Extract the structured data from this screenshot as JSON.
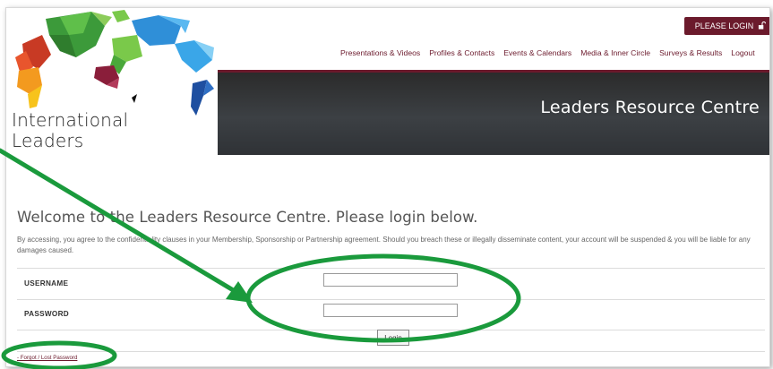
{
  "header": {
    "logo_line1": "International",
    "logo_line2": "Leaders",
    "login_button": "PLEASE LOGIN",
    "login_icon": "unlock-icon"
  },
  "nav": {
    "items": [
      {
        "label": "Presentations & Videos"
      },
      {
        "label": "Profiles & Contacts"
      },
      {
        "label": "Events & Calendars"
      },
      {
        "label": "Media & Inner Circle"
      },
      {
        "label": "Surveys & Results"
      },
      {
        "label": "Logout"
      }
    ]
  },
  "banner": {
    "title": "Leaders Resource Centre"
  },
  "main": {
    "welcome": "Welcome to the Leaders Resource Centre. Please login below.",
    "notice": "By accessing, you agree to the confidentiality clauses in your Membership, Sponsorship or Partnership agreement. Should you breach these or illegally disseminate content, your account will be suspended & you will be liable for any damages caused.",
    "username_label": "USERNAME",
    "username_value": "",
    "password_label": "PASSWORD",
    "password_value": "",
    "submit_label": "Login",
    "forgot_label": "- Forgot / Lost Password"
  },
  "colors": {
    "accent": "#6b1a2c",
    "annotation": "#1a9a3c",
    "banner": "#3a3d41"
  }
}
